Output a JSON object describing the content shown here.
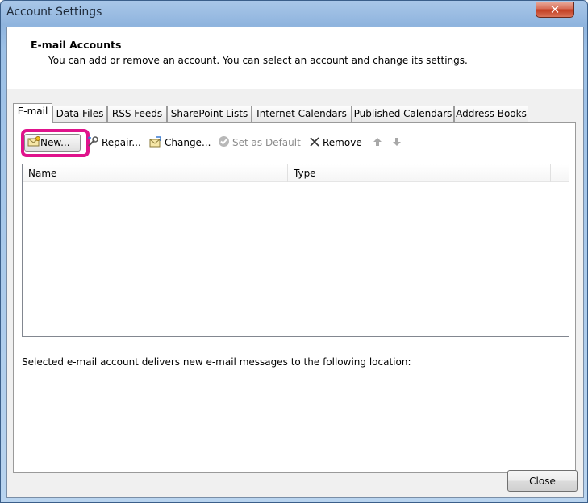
{
  "window": {
    "title": "Account Settings",
    "close_glyph": "✕"
  },
  "header": {
    "title": "E-mail Accounts",
    "subtitle": "You can add or remove an account. You can select an account and change its settings."
  },
  "tabs": [
    {
      "label": "E-mail",
      "active": true
    },
    {
      "label": "Data Files"
    },
    {
      "label": "RSS Feeds"
    },
    {
      "label": "SharePoint Lists"
    },
    {
      "label": "Internet Calendars"
    },
    {
      "label": "Published Calendars"
    },
    {
      "label": "Address Books"
    }
  ],
  "toolbar": {
    "new_label": "New...",
    "repair_label": "Repair...",
    "change_label": "Change...",
    "set_default_label": "Set as Default",
    "remove_label": "Remove",
    "up_glyph": "🡅",
    "down_glyph": "🡇",
    "highlight_color": "#e0138c"
  },
  "list": {
    "columns": [
      "Name",
      "Type"
    ],
    "rows": []
  },
  "location_text": "Selected e-mail account delivers new e-mail messages to the following location:",
  "footer": {
    "close_label": "Close"
  }
}
